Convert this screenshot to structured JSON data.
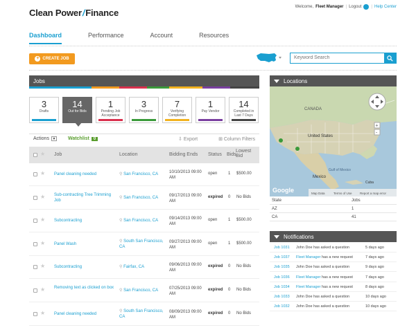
{
  "header": {
    "logo_left": "Clean Power",
    "logo_bolt": "/",
    "logo_right": "Finance",
    "welcome": "Welcome,",
    "user": "Fleet Manager",
    "logout": "Logout",
    "help": "Help Center"
  },
  "nav": {
    "tabs": [
      "Dashboard",
      "Performance",
      "Account",
      "Resources"
    ],
    "active": "Dashboard"
  },
  "create_job": "CREATE JOB",
  "search": {
    "placeholder": "Keyword Search"
  },
  "jobs": {
    "title": "Jobs",
    "cards": [
      {
        "count": "3",
        "label": "Drafts",
        "color": "#1a9fd0"
      },
      {
        "count": "14",
        "label": "Out for Bids",
        "color": "#666666",
        "active": true
      },
      {
        "count": "1",
        "label": "Pending Job Acceptance",
        "color": "#d9304d"
      },
      {
        "count": "3",
        "label": "In Progress",
        "color": "#3a9a3a"
      },
      {
        "count": "7",
        "label": "Verifying Completion",
        "color": "#f2b21f"
      },
      {
        "count": "1",
        "label": "Pay Vendor",
        "color": "#7a3fa0"
      },
      {
        "count": "14",
        "label": "Completed in Last 7 Days",
        "color": "#444444"
      }
    ],
    "toolbar": {
      "actions": "Actions",
      "watchlist": "Watchlist",
      "watch_count": "0",
      "export": "Export",
      "filters": "Column Filters"
    },
    "columns": {
      "job": "Job",
      "location": "Location",
      "bidding": "Bidding Ends",
      "status": "Status",
      "bids": "Bids",
      "lowest_1": "Lowest",
      "lowest_2": "Bid"
    },
    "rows": [
      {
        "job": "Panel cleaning needed",
        "location": "San Francisco, CA",
        "ends_1": "10/10/2013 09:00",
        "ends_2": "AM",
        "status": "open",
        "bids": "1",
        "lowest": "$500.00"
      },
      {
        "job": "Sub-contracting Tree Trimming Job",
        "location": "San Francisco, CA",
        "ends_1": "09/17/2013 09:00",
        "ends_2": "AM",
        "status": "expired",
        "bids": "0",
        "lowest": "No Bids"
      },
      {
        "job": "Subcontracting",
        "location": "San Francisco, CA",
        "ends_1": "09/14/2013 09:00",
        "ends_2": "AM",
        "status": "open",
        "bids": "1",
        "lowest": "$500.00"
      },
      {
        "job": "Panel Wash",
        "location": "South San Francisco, CA",
        "ends_1": "09/27/2013 09:00",
        "ends_2": "AM",
        "status": "open",
        "bids": "1",
        "lowest": "$500.00"
      },
      {
        "job": "Subcontracting",
        "location": "Fairfax, CA",
        "ends_1": "09/06/2013 09:00",
        "ends_2": "AM",
        "status": "expired",
        "bids": "0",
        "lowest": "No Bids"
      },
      {
        "job": "Removing text as clicked on box",
        "location": "San Francisco, CA",
        "ends_1": "07/25/2013 09:00",
        "ends_2": "AM",
        "status": "expired",
        "bids": "0",
        "lowest": "No Bids"
      },
      {
        "job": "Panel cleaning needed",
        "location": "South San Francisco, CA",
        "ends_1": "08/09/2013 09:00",
        "ends_2": "AM",
        "status": "expired",
        "bids": "0",
        "lowest": "No Bids"
      }
    ]
  },
  "locations": {
    "title": "Locations",
    "map_labels": [
      "CANADA",
      "United States",
      "Gulf of Mexico",
      "Mexico",
      "Cuba",
      "Google"
    ],
    "attribution": [
      "Map Data",
      "Terms of Use",
      "Report a map error"
    ],
    "table_header": [
      "State",
      "Jobs"
    ],
    "rows": [
      {
        "state": "AZ",
        "jobs": "1"
      },
      {
        "state": "CA",
        "jobs": "41"
      }
    ]
  },
  "notifications": {
    "title": "Notifications",
    "items": [
      {
        "job": "Job 1031",
        "who": "John Doe",
        "text": "has asked a question",
        "when": "5 days ago"
      },
      {
        "job": "Job 1037",
        "who": "Fleet Manager",
        "text": "has a new request",
        "when": "7 days ago"
      },
      {
        "job": "Job 1035",
        "who": "John Doe",
        "text": "has asked a question",
        "when": "9 days ago"
      },
      {
        "job": "Job 1036",
        "who": "Fleet Manager",
        "text": "has a new request",
        "when": "7 days ago"
      },
      {
        "job": "Job 1034",
        "who": "Fleet Manager",
        "text": "has a new request",
        "when": "8 days ago"
      },
      {
        "job": "Job 1033",
        "who": "John Doe",
        "text": "has asked a question",
        "when": "10 days ago"
      },
      {
        "job": "Job 1032",
        "who": "John Doe",
        "text": "has asked a question",
        "when": "10 days ago"
      }
    ]
  }
}
